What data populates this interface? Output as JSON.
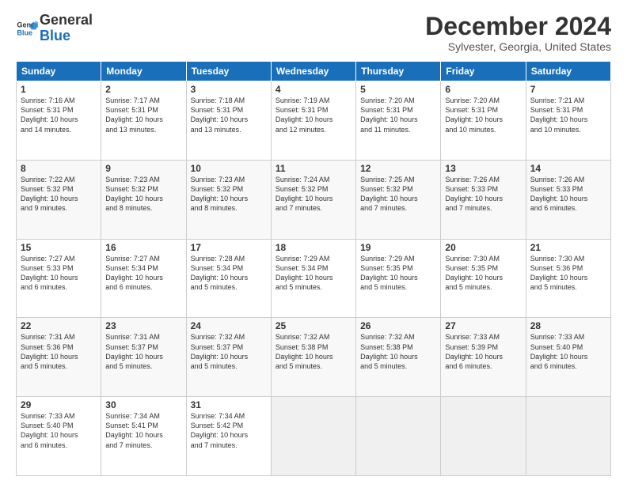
{
  "logo": {
    "line1": "General",
    "line2": "Blue"
  },
  "title": "December 2024",
  "location": "Sylvester, Georgia, United States",
  "headers": [
    "Sunday",
    "Monday",
    "Tuesday",
    "Wednesday",
    "Thursday",
    "Friday",
    "Saturday"
  ],
  "weeks": [
    [
      {
        "day": "1",
        "info": "Sunrise: 7:16 AM\nSunset: 5:31 PM\nDaylight: 10 hours\nand 14 minutes."
      },
      {
        "day": "2",
        "info": "Sunrise: 7:17 AM\nSunset: 5:31 PM\nDaylight: 10 hours\nand 13 minutes."
      },
      {
        "day": "3",
        "info": "Sunrise: 7:18 AM\nSunset: 5:31 PM\nDaylight: 10 hours\nand 13 minutes."
      },
      {
        "day": "4",
        "info": "Sunrise: 7:19 AM\nSunset: 5:31 PM\nDaylight: 10 hours\nand 12 minutes."
      },
      {
        "day": "5",
        "info": "Sunrise: 7:20 AM\nSunset: 5:31 PM\nDaylight: 10 hours\nand 11 minutes."
      },
      {
        "day": "6",
        "info": "Sunrise: 7:20 AM\nSunset: 5:31 PM\nDaylight: 10 hours\nand 10 minutes."
      },
      {
        "day": "7",
        "info": "Sunrise: 7:21 AM\nSunset: 5:31 PM\nDaylight: 10 hours\nand 10 minutes."
      }
    ],
    [
      {
        "day": "8",
        "info": "Sunrise: 7:22 AM\nSunset: 5:32 PM\nDaylight: 10 hours\nand 9 minutes."
      },
      {
        "day": "9",
        "info": "Sunrise: 7:23 AM\nSunset: 5:32 PM\nDaylight: 10 hours\nand 8 minutes."
      },
      {
        "day": "10",
        "info": "Sunrise: 7:23 AM\nSunset: 5:32 PM\nDaylight: 10 hours\nand 8 minutes."
      },
      {
        "day": "11",
        "info": "Sunrise: 7:24 AM\nSunset: 5:32 PM\nDaylight: 10 hours\nand 7 minutes."
      },
      {
        "day": "12",
        "info": "Sunrise: 7:25 AM\nSunset: 5:32 PM\nDaylight: 10 hours\nand 7 minutes."
      },
      {
        "day": "13",
        "info": "Sunrise: 7:26 AM\nSunset: 5:33 PM\nDaylight: 10 hours\nand 7 minutes."
      },
      {
        "day": "14",
        "info": "Sunrise: 7:26 AM\nSunset: 5:33 PM\nDaylight: 10 hours\nand 6 minutes."
      }
    ],
    [
      {
        "day": "15",
        "info": "Sunrise: 7:27 AM\nSunset: 5:33 PM\nDaylight: 10 hours\nand 6 minutes."
      },
      {
        "day": "16",
        "info": "Sunrise: 7:27 AM\nSunset: 5:34 PM\nDaylight: 10 hours\nand 6 minutes."
      },
      {
        "day": "17",
        "info": "Sunrise: 7:28 AM\nSunset: 5:34 PM\nDaylight: 10 hours\nand 5 minutes."
      },
      {
        "day": "18",
        "info": "Sunrise: 7:29 AM\nSunset: 5:34 PM\nDaylight: 10 hours\nand 5 minutes."
      },
      {
        "day": "19",
        "info": "Sunrise: 7:29 AM\nSunset: 5:35 PM\nDaylight: 10 hours\nand 5 minutes."
      },
      {
        "day": "20",
        "info": "Sunrise: 7:30 AM\nSunset: 5:35 PM\nDaylight: 10 hours\nand 5 minutes."
      },
      {
        "day": "21",
        "info": "Sunrise: 7:30 AM\nSunset: 5:36 PM\nDaylight: 10 hours\nand 5 minutes."
      }
    ],
    [
      {
        "day": "22",
        "info": "Sunrise: 7:31 AM\nSunset: 5:36 PM\nDaylight: 10 hours\nand 5 minutes."
      },
      {
        "day": "23",
        "info": "Sunrise: 7:31 AM\nSunset: 5:37 PM\nDaylight: 10 hours\nand 5 minutes."
      },
      {
        "day": "24",
        "info": "Sunrise: 7:32 AM\nSunset: 5:37 PM\nDaylight: 10 hours\nand 5 minutes."
      },
      {
        "day": "25",
        "info": "Sunrise: 7:32 AM\nSunset: 5:38 PM\nDaylight: 10 hours\nand 5 minutes."
      },
      {
        "day": "26",
        "info": "Sunrise: 7:32 AM\nSunset: 5:38 PM\nDaylight: 10 hours\nand 5 minutes."
      },
      {
        "day": "27",
        "info": "Sunrise: 7:33 AM\nSunset: 5:39 PM\nDaylight: 10 hours\nand 6 minutes."
      },
      {
        "day": "28",
        "info": "Sunrise: 7:33 AM\nSunset: 5:40 PM\nDaylight: 10 hours\nand 6 minutes."
      }
    ],
    [
      {
        "day": "29",
        "info": "Sunrise: 7:33 AM\nSunset: 5:40 PM\nDaylight: 10 hours\nand 6 minutes."
      },
      {
        "day": "30",
        "info": "Sunrise: 7:34 AM\nSunset: 5:41 PM\nDaylight: 10 hours\nand 7 minutes."
      },
      {
        "day": "31",
        "info": "Sunrise: 7:34 AM\nSunset: 5:42 PM\nDaylight: 10 hours\nand 7 minutes."
      },
      {
        "day": "",
        "info": ""
      },
      {
        "day": "",
        "info": ""
      },
      {
        "day": "",
        "info": ""
      },
      {
        "day": "",
        "info": ""
      }
    ]
  ]
}
